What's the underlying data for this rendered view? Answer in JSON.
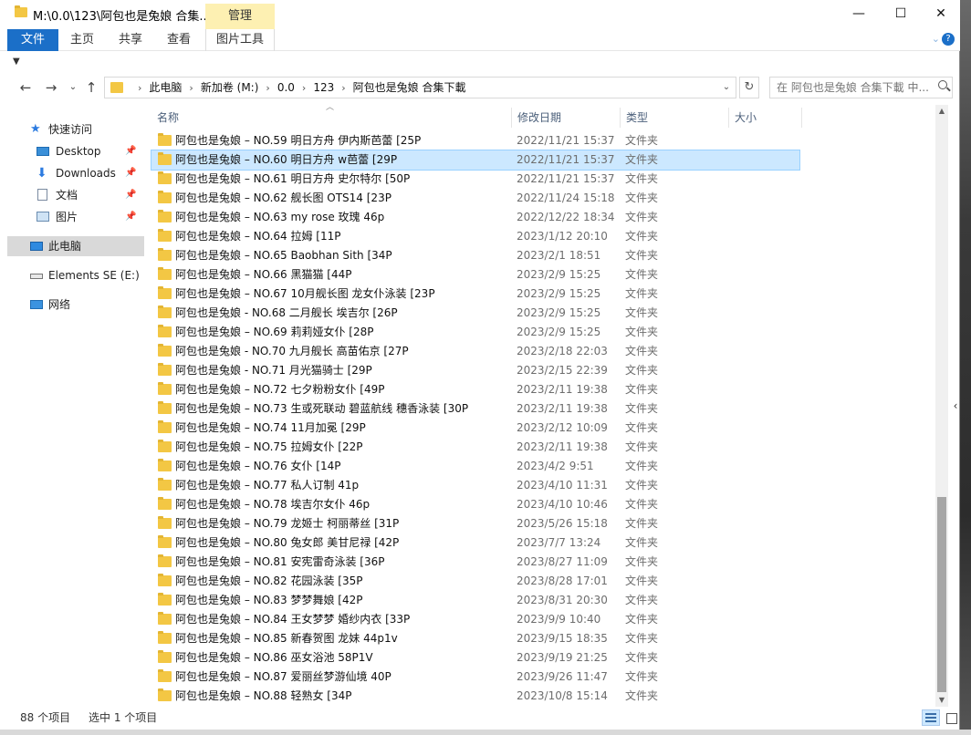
{
  "title": "M:\\0.0\\123\\阿包也是兔娘 合集...",
  "manage_tab": "管理",
  "window_controls": {
    "minimize": "—",
    "maximize": "☐",
    "close": "✕"
  },
  "ribbon": {
    "tabs": [
      "文件",
      "主页",
      "共享",
      "查看",
      "图片工具"
    ]
  },
  "address": {
    "crumbs": [
      "此电脑",
      "新加卷 (M:)",
      "0.0",
      "123",
      "阿包也是兔娘 合集下載"
    ]
  },
  "search": {
    "placeholder": "在 阿包也是兔娘 合集下載 中..."
  },
  "nav": {
    "quick_access": "快速访问",
    "items": [
      {
        "label": "Desktop",
        "icon": "desktop-icon"
      },
      {
        "label": "Downloads",
        "icon": "downloads-icon"
      },
      {
        "label": "文档",
        "icon": "documents-icon"
      },
      {
        "label": "图片",
        "icon": "pictures-icon"
      }
    ],
    "this_pc": "此电脑",
    "drive": "Elements SE (E:)",
    "network": "网络"
  },
  "columns": {
    "name": "名称",
    "date": "修改日期",
    "type": "类型",
    "size": "大小"
  },
  "files": [
    {
      "name": "阿包也是兔娘 – NO.59 明日方舟 伊内斯芭蕾 [25P",
      "date": "2022/11/21 15:37",
      "type": "文件夹"
    },
    {
      "name": "阿包也是兔娘 – NO.60 明日方舟 w芭蕾 [29P",
      "date": "2022/11/21 15:37",
      "type": "文件夹",
      "selected": true
    },
    {
      "name": "阿包也是兔娘 – NO.61 明日方舟 史尔特尔 [50P",
      "date": "2022/11/21 15:37",
      "type": "文件夹"
    },
    {
      "name": "阿包也是兔娘 – NO.62 舰长图 OTS14 [23P",
      "date": "2022/11/24 15:18",
      "type": "文件夹"
    },
    {
      "name": "阿包也是兔娘 – NO.63 my rose 玫瑰 46p",
      "date": "2022/12/22 18:34",
      "type": "文件夹"
    },
    {
      "name": "阿包也是兔娘 – NO.64 拉姆 [11P",
      "date": "2023/1/12 20:10",
      "type": "文件夹"
    },
    {
      "name": "阿包也是兔娘 – NO.65 Baobhan Sith [34P",
      "date": "2023/2/1 18:51",
      "type": "文件夹"
    },
    {
      "name": "阿包也是兔娘 – NO.66 黑猫猫 [44P",
      "date": "2023/2/9 15:25",
      "type": "文件夹"
    },
    {
      "name": "阿包也是兔娘 – NO.67 10月舰长图 龙女仆泳装 [23P",
      "date": "2023/2/9 15:25",
      "type": "文件夹"
    },
    {
      "name": "阿包也是兔娘 - NO.68 二月舰长 埃吉尔 [26P",
      "date": "2023/2/9 15:25",
      "type": "文件夹"
    },
    {
      "name": "阿包也是兔娘 – NO.69 莉莉娅女仆 [28P",
      "date": "2023/2/9 15:25",
      "type": "文件夹"
    },
    {
      "name": "阿包也是兔娘 - NO.70 九月舰长 高苗佑京 [27P",
      "date": "2023/2/18 22:03",
      "type": "文件夹"
    },
    {
      "name": "阿包也是兔娘 - NO.71 月光猫骑士 [29P",
      "date": "2023/2/15 22:39",
      "type": "文件夹"
    },
    {
      "name": "阿包也是兔娘 – NO.72 七夕粉粉女仆 [49P",
      "date": "2023/2/11 19:38",
      "type": "文件夹"
    },
    {
      "name": "阿包也是兔娘 – NO.73 生或死联动 碧蓝航线 穗香泳装 [30P",
      "date": "2023/2/11 19:38",
      "type": "文件夹"
    },
    {
      "name": "阿包也是兔娘 – NO.74 11月加冕 [29P",
      "date": "2023/2/12 10:09",
      "type": "文件夹"
    },
    {
      "name": "阿包也是兔娘 – NO.75 拉姆女仆 [22P",
      "date": "2023/2/11 19:38",
      "type": "文件夹"
    },
    {
      "name": "阿包也是兔娘 – NO.76 女仆 [14P",
      "date": "2023/4/2 9:51",
      "type": "文件夹"
    },
    {
      "name": "阿包也是兔娘 – NO.77 私人订制 41p",
      "date": "2023/4/10 11:31",
      "type": "文件夹"
    },
    {
      "name": "阿包也是兔娘 – NO.78 埃吉尔女仆 46p",
      "date": "2023/4/10 10:46",
      "type": "文件夹"
    },
    {
      "name": "阿包也是兔娘 – NO.79 龙姬士 柯丽蒂丝 [31P",
      "date": "2023/5/26 15:18",
      "type": "文件夹"
    },
    {
      "name": "阿包也是兔娘 – NO.80 兔女郎 美甘尼禄 [42P",
      "date": "2023/7/7 13:24",
      "type": "文件夹"
    },
    {
      "name": "阿包也是兔娘 – NO.81 安宪雷奇泳装 [36P",
      "date": "2023/8/27 11:09",
      "type": "文件夹"
    },
    {
      "name": "阿包也是兔娘 – NO.82 花园泳装 [35P",
      "date": "2023/8/28 17:01",
      "type": "文件夹"
    },
    {
      "name": "阿包也是兔娘 – NO.83 梦梦舞娘 [42P",
      "date": "2023/8/31 20:30",
      "type": "文件夹"
    },
    {
      "name": "阿包也是兔娘 – NO.84 王女梦梦 婚纱内衣 [33P",
      "date": "2023/9/9 10:40",
      "type": "文件夹"
    },
    {
      "name": "阿包也是兔娘 – NO.85 新春贺图 龙妹 44p1v",
      "date": "2023/9/15 18:35",
      "type": "文件夹"
    },
    {
      "name": "阿包也是兔娘 – NO.86 巫女浴池 58P1V",
      "date": "2023/9/19 21:25",
      "type": "文件夹"
    },
    {
      "name": "阿包也是兔娘 – NO.87 爱丽丝梦游仙境 40P",
      "date": "2023/9/26 11:47",
      "type": "文件夹"
    },
    {
      "name": "阿包也是兔娘 – NO.88 轻熟女 [34P",
      "date": "2023/10/8 15:14",
      "type": "文件夹"
    }
  ],
  "status": {
    "count": "88 个项目",
    "selected": "选中 1 个项目"
  },
  "colors": {
    "accent": "#1b6fc8",
    "selection": "#cce8ff",
    "manage_tab": "#fdf0b2",
    "folder": "#f3c744"
  }
}
